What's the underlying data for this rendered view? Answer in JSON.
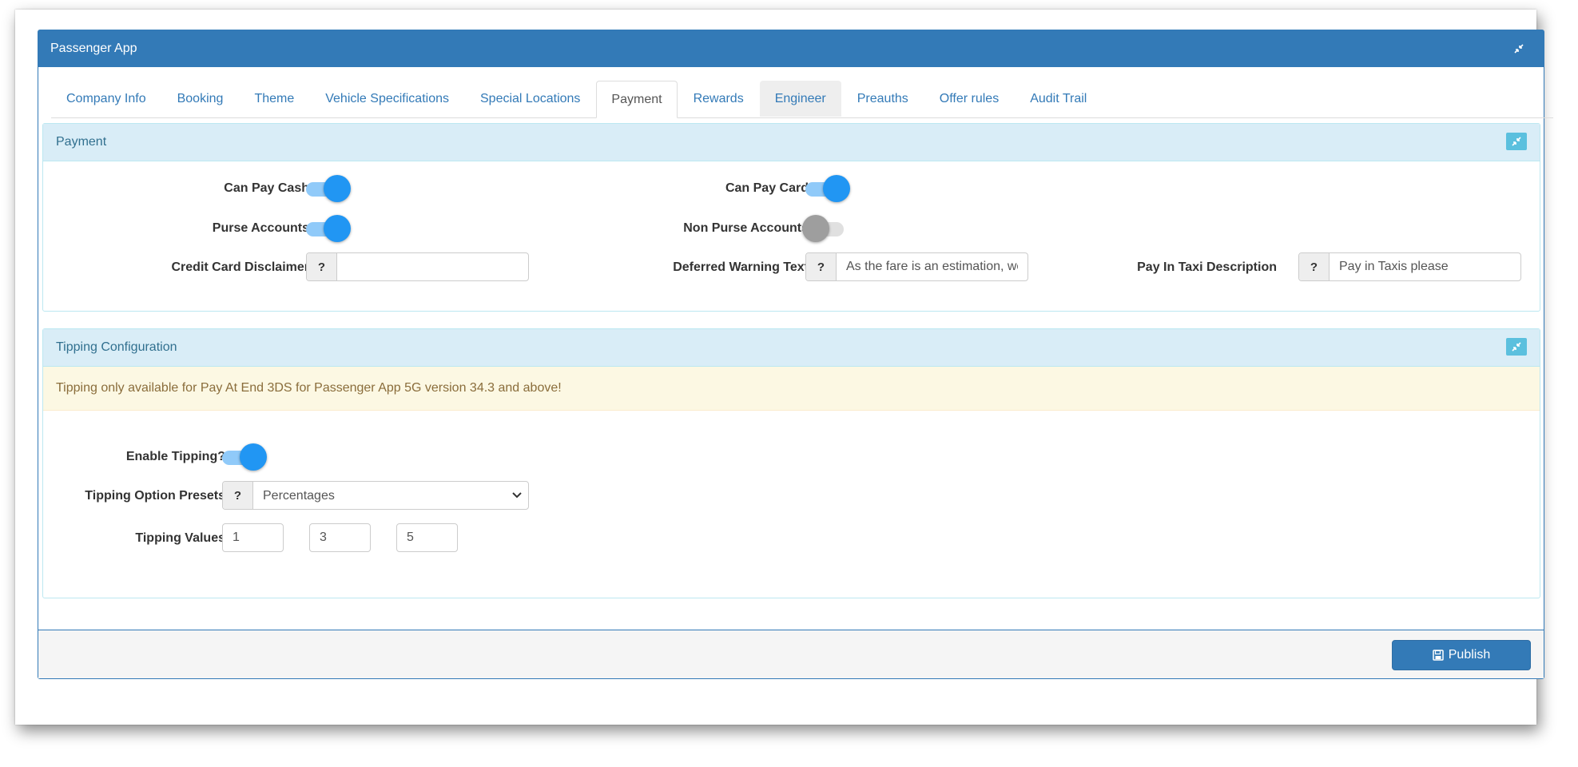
{
  "app": {
    "title": "Passenger App"
  },
  "tabs": [
    {
      "label": "Company Info"
    },
    {
      "label": "Booking"
    },
    {
      "label": "Theme"
    },
    {
      "label": "Vehicle Specifications"
    },
    {
      "label": "Special Locations"
    },
    {
      "label": "Payment",
      "active": true
    },
    {
      "label": "Rewards"
    },
    {
      "label": "Engineer"
    },
    {
      "label": "Preauths"
    },
    {
      "label": "Offer rules"
    },
    {
      "label": "Audit Trail"
    }
  ],
  "payment": {
    "title": "Payment",
    "can_pay_cash": {
      "label": "Can Pay Cash",
      "on": true
    },
    "can_pay_card": {
      "label": "Can Pay Card",
      "on": true
    },
    "purse_accounts": {
      "label": "Purse Accounts",
      "on": true
    },
    "non_purse_accounts": {
      "label": "Non Purse Accounts",
      "on": false
    },
    "credit_card_disclaimer": {
      "label": "Credit Card Disclaimer",
      "value": "",
      "help": "?"
    },
    "deferred_warning_text": {
      "label": "Deferred Warning Text",
      "value": "As the fare is an estimation, we",
      "help": "?"
    },
    "pay_in_taxi_description": {
      "label": "Pay In Taxi Description",
      "value": "Pay in Taxis please",
      "help": "?"
    }
  },
  "tipping": {
    "title": "Tipping Configuration",
    "notice": "Tipping only available for Pay At End 3DS for Passenger App 5G version 34.3 and above!",
    "enable": {
      "label": "Enable Tipping?",
      "on": true
    },
    "presets": {
      "label": "Tipping Option Presets",
      "value": "Percentages",
      "help": "?"
    },
    "values": {
      "label": "Tipping Values",
      "items": [
        "1",
        "3",
        "5"
      ]
    }
  },
  "footer": {
    "publish_label": "Publish"
  },
  "colors": {
    "primary": "#337ab7",
    "info_bg": "#d9edf7",
    "toggle_on": "#2196f3",
    "warning_bg": "#fcf8e3"
  },
  "icons": {
    "collapse": "compress-icon",
    "publish": "save-icon"
  }
}
